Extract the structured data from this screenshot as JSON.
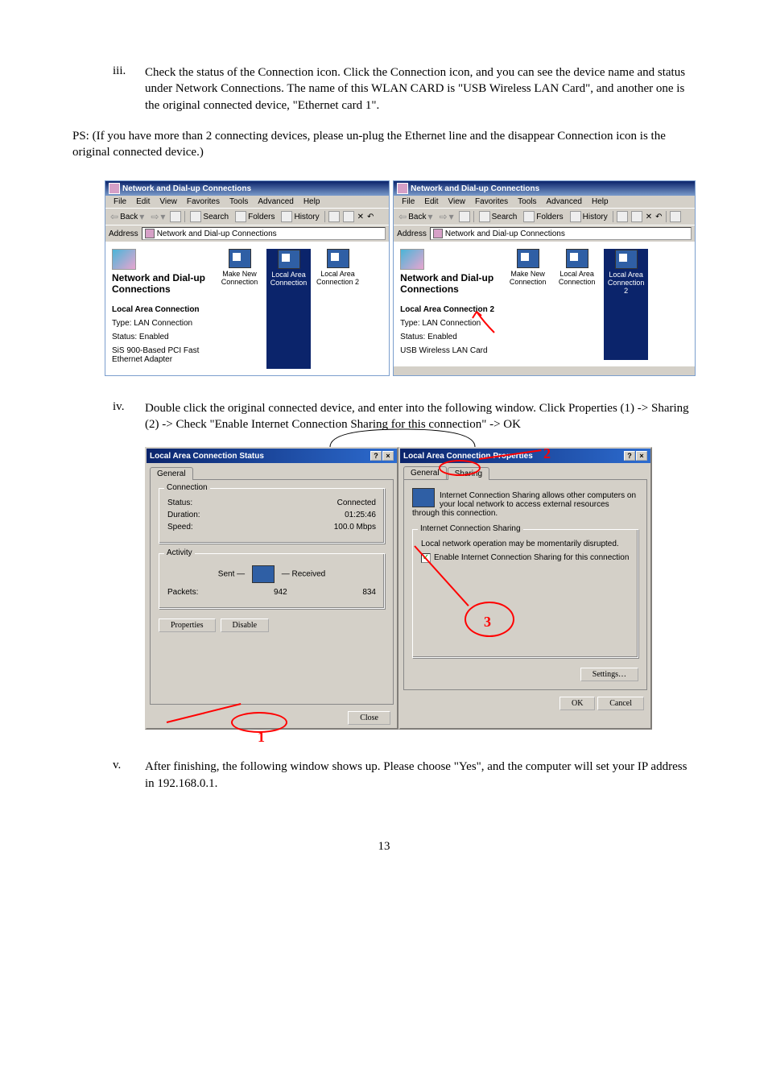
{
  "steps": {
    "iii": {
      "num": "iii.",
      "text": "Check the status of the Connection icon. Click the Connection icon, and you can see the device name and status under Network Connections. The name of this WLAN CARD is \"USB Wireless LAN Card\", and another one is the original connected device, \"Ethernet card 1\"."
    },
    "iv": {
      "num": "iv.",
      "text": "Double click the original connected device, and enter into the following window. Click Properties (1) -> Sharing (2) -> Check \"Enable Internet Connection Sharing for this connection\" -> OK"
    },
    "v": {
      "num": "v.",
      "text": "After finishing, the following window shows up. Please choose \"Yes\", and the computer will set your IP address in 192.168.0.1."
    }
  },
  "ps": "PS: (If you have more than 2 connecting devices, please un-plug the Ethernet line and the disappear Connection icon is the original connected device.)",
  "win_title": "Network and Dial-up Connections",
  "menus": {
    "file": "File",
    "edit": "Edit",
    "view": "View",
    "favorites": "Favorites",
    "tools": "Tools",
    "advanced": "Advanced",
    "help": "Help"
  },
  "toolbar": {
    "back": "Back",
    "search": "Search",
    "folders": "Folders",
    "history": "History"
  },
  "addr_label": "Address",
  "addr_value": "Network and Dial-up Connections",
  "pane_title": "Network and Dial-up Connections",
  "icons": {
    "make_new": "Make New Connection",
    "lac": "Local Area Connection",
    "lac2": "Local Area Connection 2"
  },
  "left1": {
    "sel_title": "Local Area Connection",
    "type_label": "Type:",
    "type_val": "LAN Connection",
    "status_label": "Status:",
    "status_val": "Enabled",
    "dev": "SiS 900-Based PCI Fast Ethernet Adapter"
  },
  "left2": {
    "sel_title": "Local Area Connection 2",
    "type_label": "Type:",
    "type_val": "LAN Connection",
    "status_label": "Status:",
    "status_val": "Enabled",
    "dev": "USB Wireless LAN Card"
  },
  "status_dlg": {
    "title": "Local Area Connection Status",
    "tab_general": "General",
    "grp_conn": "Connection",
    "status_l": "Status:",
    "status_v": "Connected",
    "dur_l": "Duration:",
    "dur_v": "01:25:46",
    "speed_l": "Speed:",
    "speed_v": "100.0 Mbps",
    "grp_act": "Activity",
    "sent": "Sent",
    "recv": "Received",
    "pkts_l": "Packets:",
    "pkts_sent": "942",
    "pkts_recv": "834",
    "btn_props": "Properties",
    "btn_disable": "Disable",
    "btn_close": "Close"
  },
  "props_dlg": {
    "title": "Local Area Connection Properties",
    "tab_general": "General",
    "tab_sharing": "Sharing",
    "blurb": "Internet Connection Sharing allows other computers on your local network to access external resources through this connection.",
    "grp": "Internet Connection Sharing",
    "warn": "Local network operation may be momentarily disrupted.",
    "check": "Enable Internet Connection Sharing for this connection",
    "btn_settings": "Settings…",
    "btn_ok": "OK",
    "btn_cancel": "Cancel"
  },
  "annot": {
    "n1": "1",
    "n2": "2",
    "n3": "3"
  },
  "pagenum": "13"
}
